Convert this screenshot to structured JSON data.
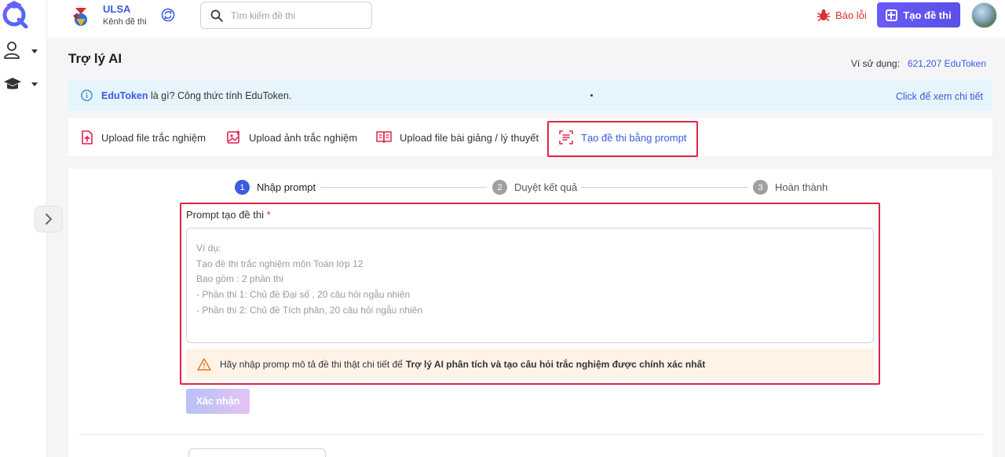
{
  "header": {
    "brand_name": "ULSA",
    "brand_sub": "Kênh đề thi",
    "search_placeholder": "Tìm kiếm đề thi",
    "report_label": "Báo lỗi",
    "create_label": "Tạo đề thi",
    "accent": "#5b4fe6",
    "report_color": "#d4322f"
  },
  "page": {
    "title": "Trợ lý AI",
    "wallet_label": "Ví sử dụng:",
    "wallet_value": "621,207 EduToken"
  },
  "banner": {
    "brand": "EduToken",
    "text": " là gì? Công thức tính EduToken.",
    "link": "Click để xem chi tiết"
  },
  "tabs": [
    {
      "label": "Upload file trắc nghiệm",
      "icon": "file-upload-icon",
      "active": false
    },
    {
      "label": "Upload ảnh trắc nghiệm",
      "icon": "image-upload-icon",
      "active": false
    },
    {
      "label": "Upload file bài giảng / lý thuyết",
      "icon": "book-icon",
      "active": false
    },
    {
      "label": "Tạo đề thi bằng prompt",
      "icon": "prompt-icon",
      "active": true
    }
  ],
  "steps": [
    {
      "num": "1",
      "label": "Nhập prompt",
      "state": "active"
    },
    {
      "num": "2",
      "label": "Duyệt kết quả",
      "state": "pending"
    },
    {
      "num": "3",
      "label": "Hoàn thành",
      "state": "pending"
    }
  ],
  "form": {
    "prompt_label": "Prompt tạo đề thi",
    "required_mark": "*",
    "prompt_value": "",
    "prompt_placeholder": "Ví dụ:\nTạo đề thi trắc nghiệm môn Toán lớp 12\nBao gồm : 2 phần thi\n- Phần thi 1: Chủ đề Đại số , 20 câu hỏi ngẫu nhiên\n- Phần thi 2: Chủ đề Tích phân, 20 câu hỏi ngẫu nhiên",
    "warning_text": "Hãy nhập promp mô tả đề thi thật chi tiết để",
    "warning_strong": "Trợ lý AI phân tích và tạo câu hỏi trắc nghiệm được chính xác nhất",
    "confirm_label": "Xác nhận"
  },
  "colors": {
    "primary": "#3b5be0",
    "highlight_border": "#e0234a",
    "banner_bg": "#e6f4fb",
    "warning_bg": "#fff3e8"
  }
}
